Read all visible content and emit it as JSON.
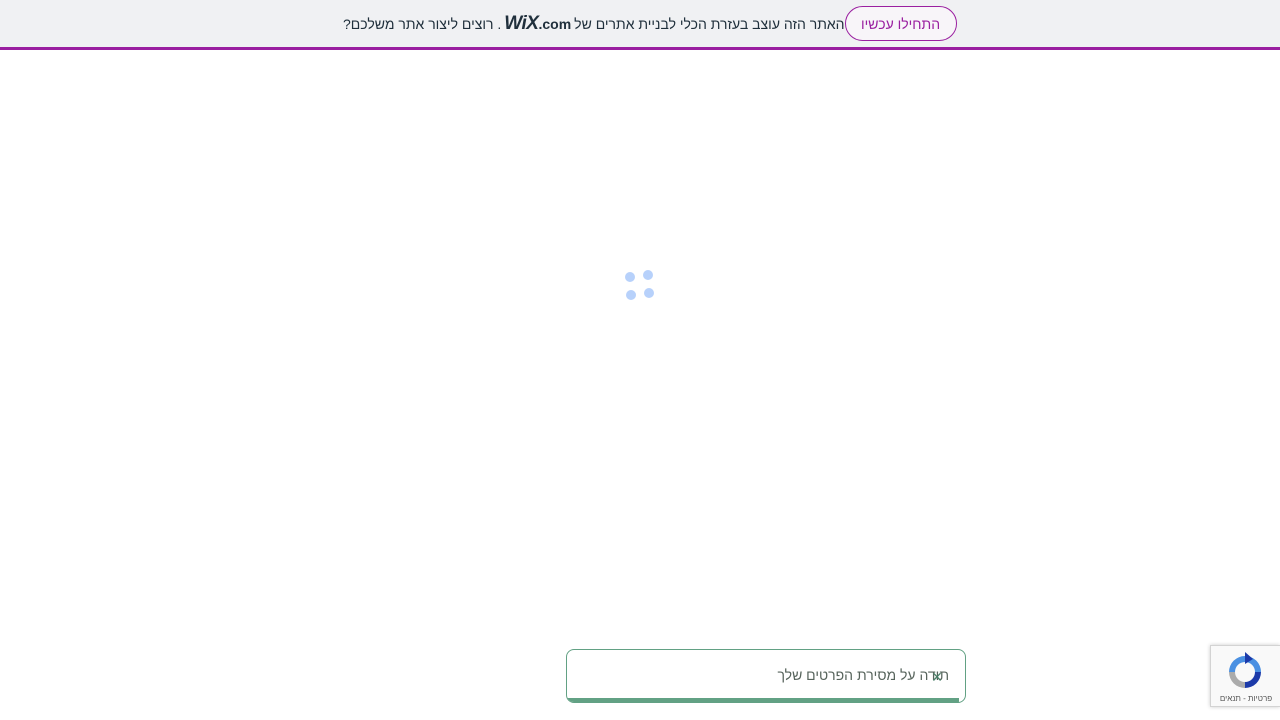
{
  "banner": {
    "text_part1": "האתר הזה עוצב בעזרת הכלי לבניית אתרים של",
    "wix_mark": "WiX",
    "wix_domain": ".com",
    "text_part2": ". רוצים ליצור אתר משלכם?",
    "cta_label": "התחילו עכשיו",
    "accent_color": "#9a1fa0"
  },
  "loader": {
    "icon": "loading-spinner-icon",
    "color": "#b7d1fb"
  },
  "toast": {
    "message": "תודה על מסירת הפרטים שלך",
    "close_symbol": "×",
    "progress": 0.985,
    "accent_color": "#62a184"
  },
  "recaptcha": {
    "icon": "recaptcha-icon",
    "privacy_label": "פרטיות",
    "separator": " - ",
    "terms_label": "תנאים"
  }
}
